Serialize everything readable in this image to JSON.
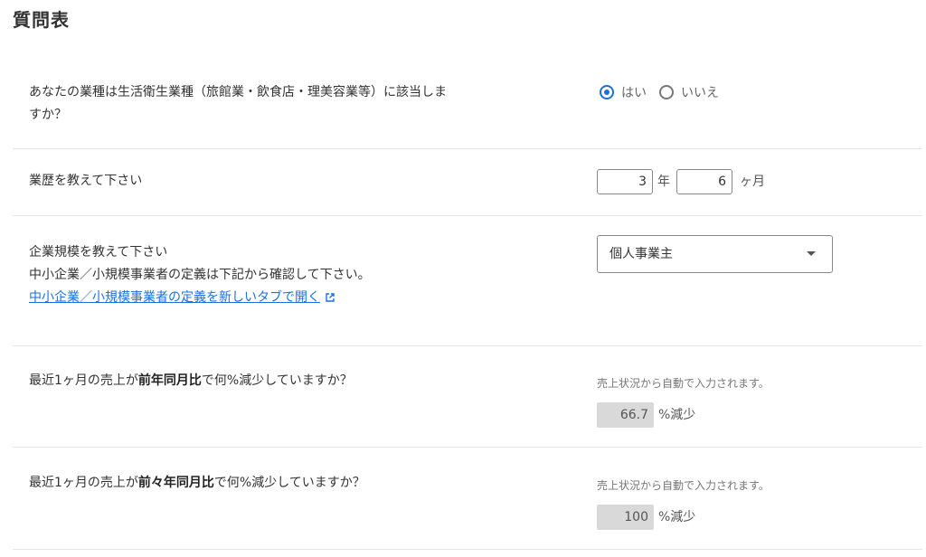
{
  "page": {
    "title": "質問表"
  },
  "q1": {
    "text_line1": "あなたの業種は生活衛生業種（旅館業・飲食店・理美容業等）に該当しま",
    "text_line2": "すか？",
    "options": [
      "はい",
      "いいえ"
    ],
    "selected": "はい"
  },
  "q2": {
    "text": "業歴を教えて下さい",
    "years": "3",
    "years_unit": "年",
    "months": "6",
    "months_unit": "ヶ月"
  },
  "q3": {
    "text_line1": "企業規模を教えて下さい",
    "text_line2": "中小企業／小規模事業者の定義は下記から確認して下さい。",
    "link_text": "中小企業／小規模事業者の定義を新しいタブで開く",
    "select_value": "個人事業主"
  },
  "q4": {
    "prefix": "最近1ヶ月の売上が",
    "bold": "前年同月比",
    "suffix": "で何%減少していますか？",
    "hint": "売上状況から自動で入力されます。",
    "value": "66.7",
    "unit": "%減少"
  },
  "q5": {
    "prefix": "最近1ヶ月の売上が",
    "bold": "前々年同月比",
    "suffix": "で何%減少していますか？",
    "hint": "売上状況から自動で入力されます。",
    "value": "100",
    "unit": "%減少"
  },
  "colors": {
    "accent": "#1e6fd9",
    "readonly_bg": "#d9d9d9",
    "divider": "#e6e6e6"
  }
}
